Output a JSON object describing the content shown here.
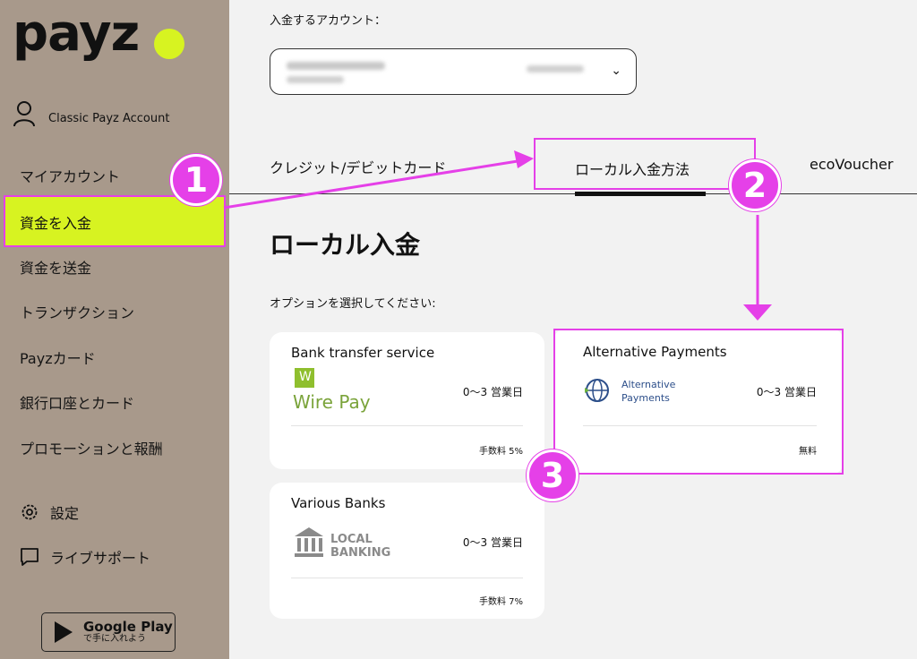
{
  "sidebar": {
    "logo": "payz",
    "account_label": "Classic Payz Account",
    "items": [
      {
        "label": "マイアカウント"
      },
      {
        "label": "資金を入金"
      },
      {
        "label": "資金を送金"
      },
      {
        "label": "トランザクション"
      },
      {
        "label": "Payzカード"
      },
      {
        "label": "銀行口座とカード"
      },
      {
        "label": "プロモーションと報酬"
      }
    ],
    "settings_label": "設定",
    "support_label": "ライブサポート",
    "google_play": {
      "title": "Google Play",
      "subtitle": "で手に入れよう"
    }
  },
  "main": {
    "account_select_label": "入金するアカウント：",
    "tabs": [
      {
        "label": "クレジット/デビットカード"
      },
      {
        "label": "ローカル入金方法"
      },
      {
        "label": "ecoVoucher"
      }
    ],
    "heading": "ローカル入金",
    "options_label": "オプションを選択してください:",
    "cards": [
      {
        "title": "Bank transfer service",
        "logo_text": "Wire Pay",
        "logo_mark": "W",
        "days": "0～3 営業日",
        "fee": "手数料 5%"
      },
      {
        "title": "Alternative Payments",
        "logo_text_1": "Alternative",
        "logo_text_2": "Payments",
        "days": "0～3 営業日",
        "fee": "無料"
      },
      {
        "title": "Various Banks",
        "logo_text_1": "LOCAL",
        "logo_text_2": "BANKING",
        "days": "0～3 営業日",
        "fee": "手数料 7%"
      }
    ]
  },
  "annotations": {
    "badges": [
      "1",
      "2",
      "3"
    ],
    "highlight_color": "#e540e8"
  },
  "colors": {
    "sidebar": "#a8998b",
    "accent": "#d7f321",
    "background": "#f2f2f2"
  }
}
